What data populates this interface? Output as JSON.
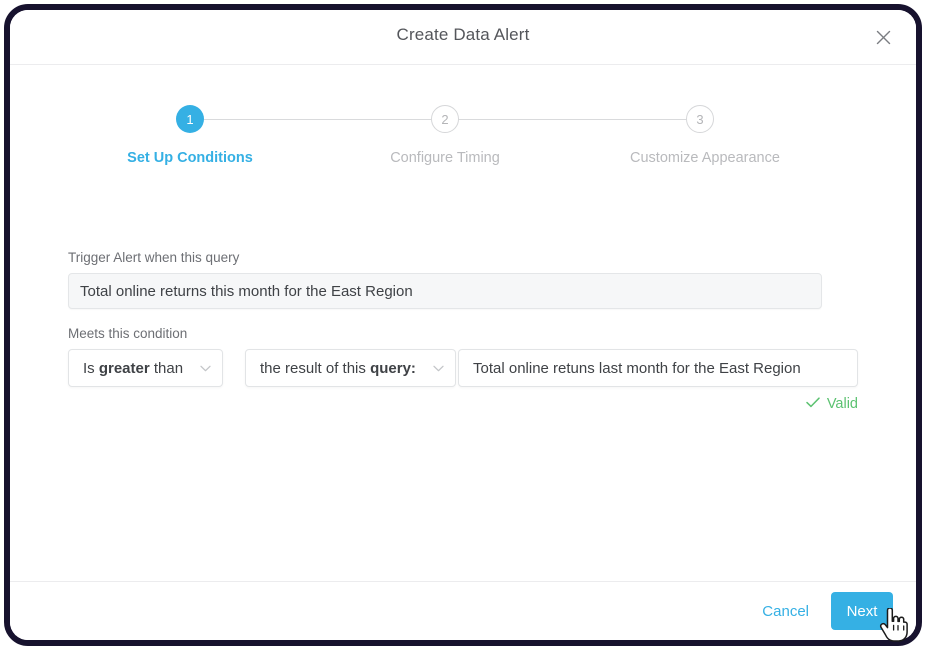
{
  "dialog": {
    "title": "Create Data Alert",
    "close_icon": "close-icon"
  },
  "stepper": {
    "steps": [
      {
        "number": "1",
        "label": "Set Up Conditions",
        "state": "active"
      },
      {
        "number": "2",
        "label": "Configure Timing",
        "state": "inactive"
      },
      {
        "number": "3",
        "label": "Customize Appearance",
        "state": "inactive"
      }
    ]
  },
  "form": {
    "trigger_label": "Trigger Alert when this query",
    "trigger_value": "Total online returns this month for the East Region",
    "condition_label": "Meets this condition",
    "operator": {
      "prefix": "Is ",
      "emphasis": "greater",
      "suffix": " than",
      "chevron_icon": "chevron-down-icon"
    },
    "subject": {
      "prefix": "the result of this ",
      "emphasis": "query:",
      "suffix": "",
      "chevron_icon": "chevron-down-icon"
    },
    "comparison_value": "Total online retuns last month for the East Region",
    "validity": {
      "text": "Valid",
      "icon": "check-icon",
      "color": "#5cc271"
    }
  },
  "footer": {
    "cancel_label": "Cancel",
    "next_label": "Next"
  },
  "colors": {
    "accent": "#35b0e4",
    "valid_green": "#5cc271",
    "frame": "#17122e",
    "muted_text": "#b9babd"
  },
  "cursor": {
    "icon": "cursor-pointer-icon"
  }
}
